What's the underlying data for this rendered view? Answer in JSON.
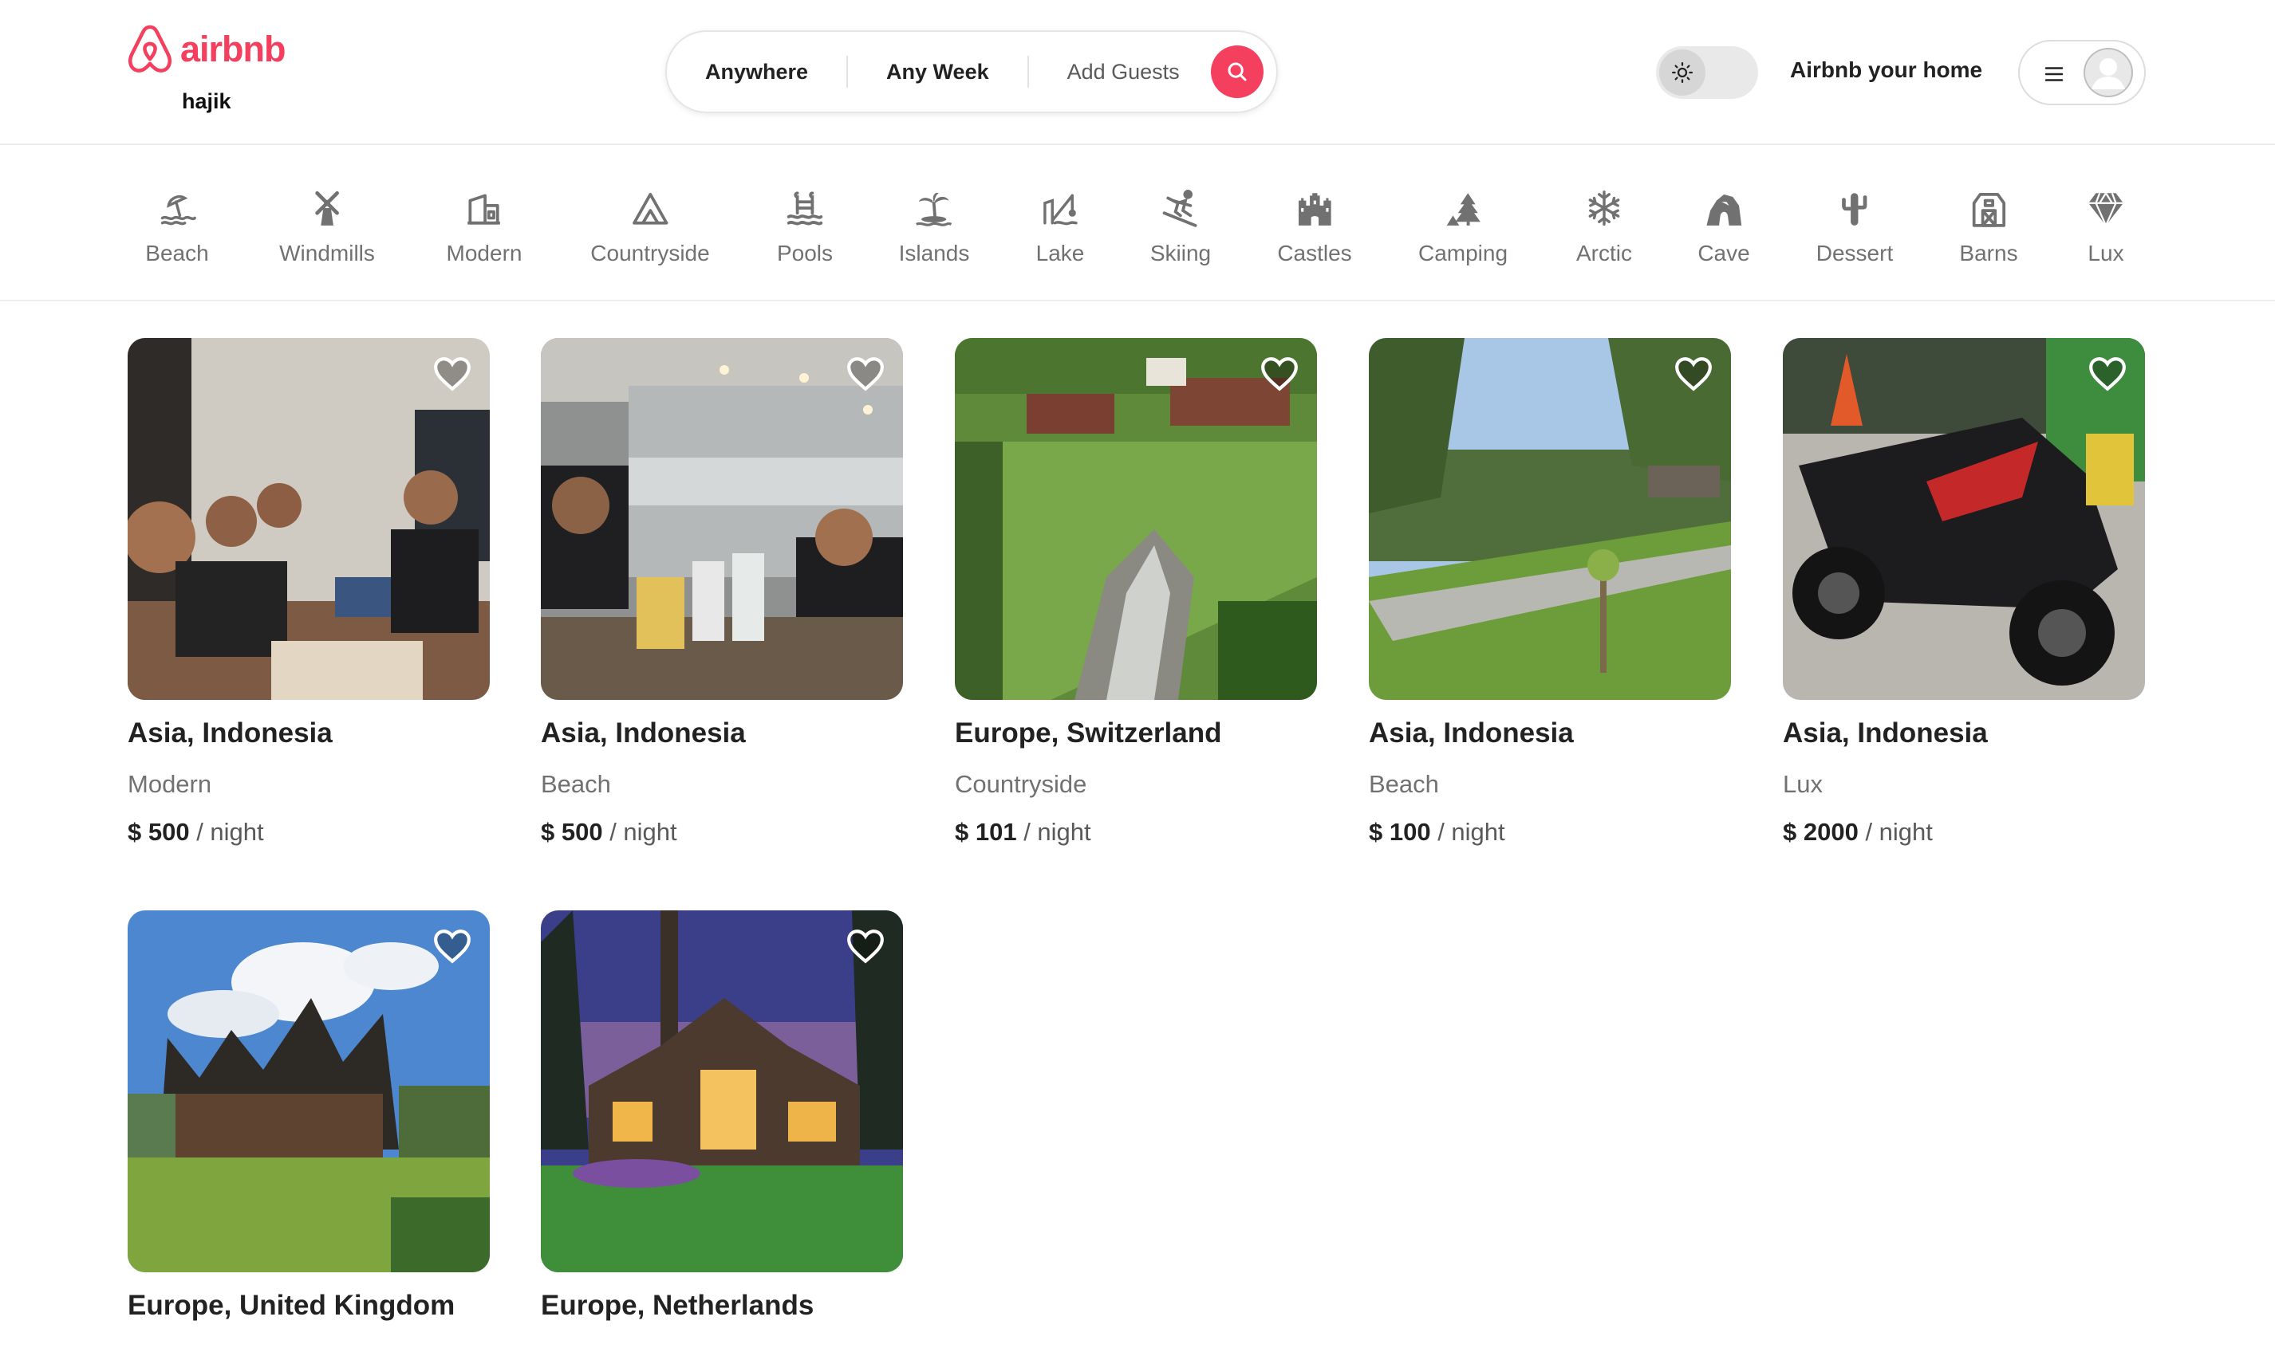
{
  "colors": {
    "accent": "#f43f5e",
    "muted_text": "#717171",
    "border": "#ebebeb"
  },
  "header": {
    "logo_text": "airbnb",
    "logo_icon": "airbnb-logo-icon",
    "username": "hajik",
    "search": {
      "where": "Anywhere",
      "when": "Any Week",
      "guests": "Add Guests",
      "button_icon": "search-icon"
    },
    "theme_toggle_icon": "sun-icon",
    "host_link": "Airbnb your home",
    "menu_icon": "hamburger-menu-icon",
    "avatar_icon": "user-avatar-icon"
  },
  "categories": [
    {
      "label": "Beach",
      "icon": "beach-umbrella-icon"
    },
    {
      "label": "Windmills",
      "icon": "windmill-icon"
    },
    {
      "label": "Modern",
      "icon": "modern-house-icon"
    },
    {
      "label": "Countryside",
      "icon": "mountain-icon"
    },
    {
      "label": "Pools",
      "icon": "pool-ladder-icon"
    },
    {
      "label": "Islands",
      "icon": "island-palm-icon"
    },
    {
      "label": "Lake",
      "icon": "fishing-lake-icon"
    },
    {
      "label": "Skiing",
      "icon": "skier-icon"
    },
    {
      "label": "Castles",
      "icon": "castle-icon"
    },
    {
      "label": "Camping",
      "icon": "camping-tree-icon"
    },
    {
      "label": "Arctic",
      "icon": "snowflake-icon"
    },
    {
      "label": "Cave",
      "icon": "cave-icon"
    },
    {
      "label": "Dessert",
      "icon": "cactus-icon"
    },
    {
      "label": "Barns",
      "icon": "barn-icon"
    },
    {
      "label": "Lux",
      "icon": "diamond-icon"
    }
  ],
  "listings": [
    {
      "location": "Asia, Indonesia",
      "category": "Modern",
      "price": "$ 500",
      "per": "/ night"
    },
    {
      "location": "Asia, Indonesia",
      "category": "Beach",
      "price": "$ 500",
      "per": "/ night"
    },
    {
      "location": "Europe, Switzerland",
      "category": "Countryside",
      "price": "$ 101",
      "per": "/ night"
    },
    {
      "location": "Asia, Indonesia",
      "category": "Beach",
      "price": "$ 100",
      "per": "/ night"
    },
    {
      "location": "Asia, Indonesia",
      "category": "Lux",
      "price": "$ 2000",
      "per": "/ night"
    },
    {
      "location": "Europe, United Kingdom"
    },
    {
      "location": "Europe, Netherlands"
    }
  ]
}
